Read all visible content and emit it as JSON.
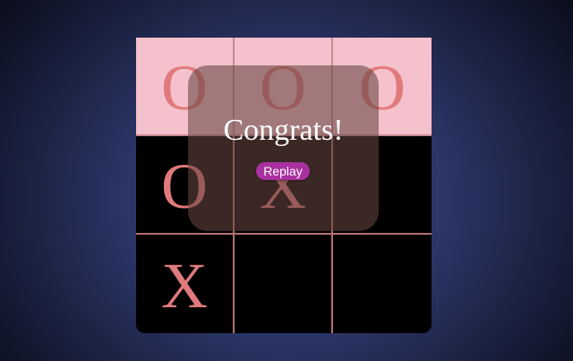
{
  "board": {
    "cells": [
      "O",
      "O",
      "O",
      "O",
      "X",
      "",
      "X",
      "",
      ""
    ],
    "winning_cells": [
      0,
      1,
      2
    ]
  },
  "overlay": {
    "title": "Congrats!",
    "replay_label": "Replay"
  },
  "colors": {
    "mark": "#e07a7d",
    "win_highlight": "#f5c1cc",
    "grid_line": "#b5706f",
    "replay_button": "#a8319f",
    "background": "#2b3566"
  }
}
